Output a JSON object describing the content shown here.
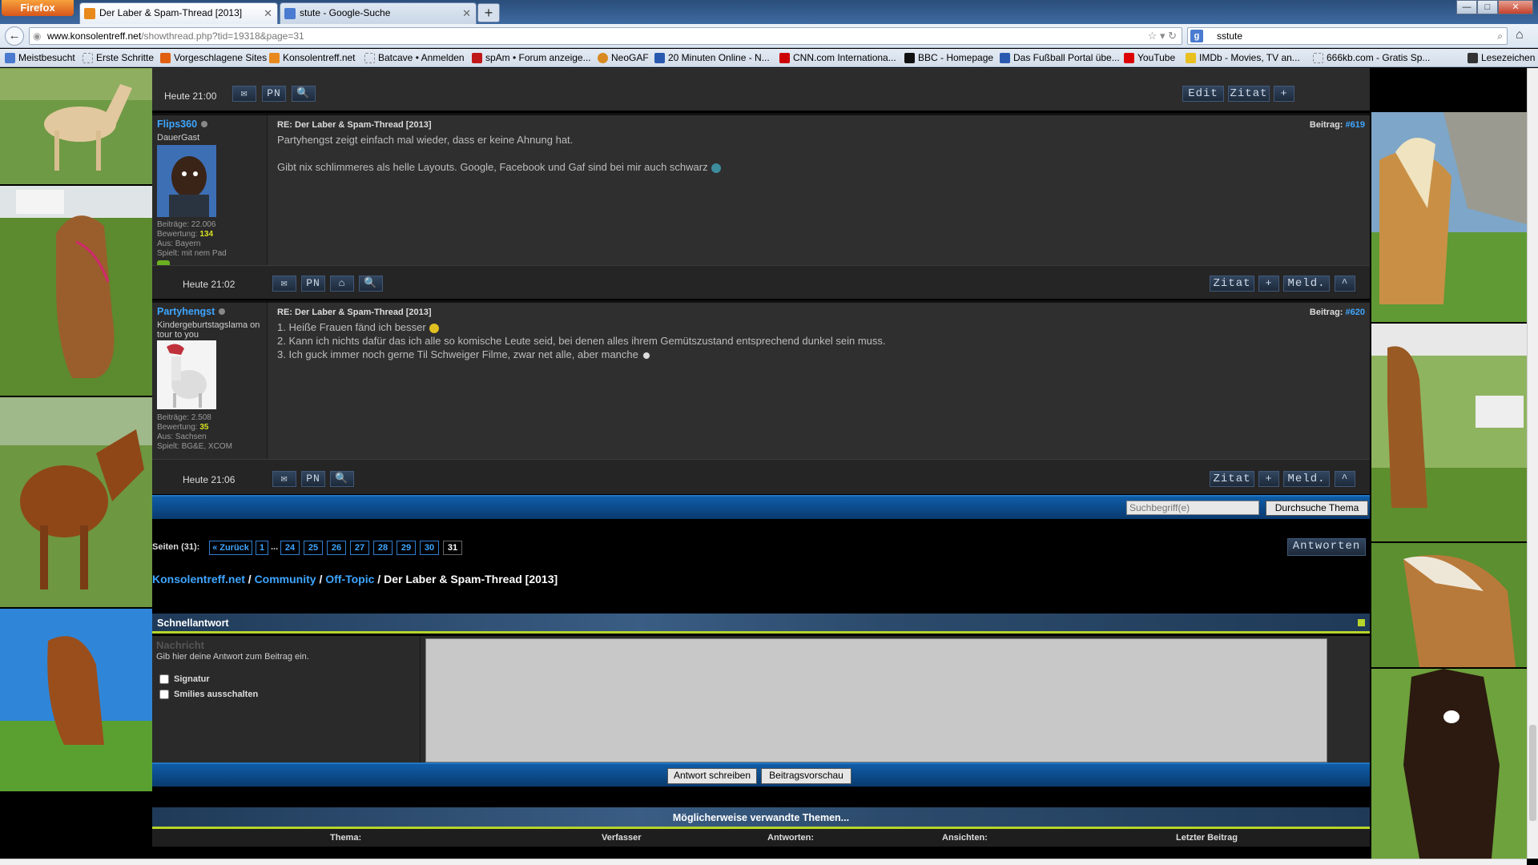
{
  "browser": {
    "menu_label": "Firefox",
    "tabs": [
      {
        "label": "Der Laber & Spam-Thread [2013]",
        "active": true
      },
      {
        "label": "stute - Google-Suche",
        "active": false
      }
    ],
    "url_host": "www.konsolentreff.net",
    "url_path": "/showthread.php?tid=19318&page=31",
    "search_value": "sstute",
    "bookmarks": [
      "Meistbesucht",
      "Erste Schritte",
      "Vorgeschlagene Sites",
      "Konsolentreff.net",
      "Batcave • Anmelden",
      "spAm • Forum anzeige...",
      "NeoGAF",
      "20 Minuten Online - N...",
      "CNN.com Internationa...",
      "BBC - Homepage",
      "Das Fußball Portal übe...",
      "YouTube",
      "IMDb - Movies, TV an...",
      "666kb.com - Gratis Sp..."
    ],
    "bookmarks_menu": "Lesezeichen"
  },
  "prev_post_footer": {
    "time": "Heute 21:00",
    "left_buttons": [
      "✉",
      "PN",
      "🔍"
    ],
    "right_buttons": [
      "Edit",
      "Zitat",
      "+"
    ]
  },
  "posts": [
    {
      "username": "Flips360",
      "user_title": "DauerGast",
      "beitraege_label": "Beiträge: 22.006",
      "bewertung_label": "Bewertung:",
      "bewertung_value": "134",
      "aus": "Aus: Bayern",
      "spielt": "Spielt: mit nem Pad",
      "title": "RE: Der Laber & Spam-Thread [2013]",
      "post_label": "Beitrag:",
      "post_number": "#619",
      "lines": [
        "Partyhengst zeigt einfach mal wieder, dass er keine Ahnung hat.",
        "",
        "Gibt nix schlimmeres als helle Layouts. Google, Facebook und Gaf sind bei mir auch schwarz"
      ],
      "time": "Heute 21:02",
      "left_buttons": [
        "✉",
        "PN",
        "⌂",
        "🔍"
      ],
      "right_buttons": [
        "Zitat",
        "+",
        "Meld.",
        "^"
      ]
    },
    {
      "username": "Partyhengst",
      "user_title": "Kindergeburtstagslama on tour to you",
      "beitraege_label": "Beiträge: 2.508",
      "bewertung_label": "Bewertung:",
      "bewertung_value": "35",
      "aus": "Aus: Sachsen",
      "spielt": "Spielt: BG&E, XCOM",
      "title": "RE: Der Laber & Spam-Thread [2013]",
      "post_label": "Beitrag:",
      "post_number": "#620",
      "lines": [
        "1. Heiße Frauen fänd ich besser",
        "2. Kann ich nichts dafür das ich alle so komische Leute seid, bei denen alles ihrem Gemütszustand entsprechend dunkel sein muss.",
        "3. Ich guck immer noch gerne Til Schweiger Filme, zwar net alle, aber manche"
      ],
      "time": "Heute 21:06",
      "left_buttons": [
        "✉",
        "PN",
        "🔍"
      ],
      "right_buttons": [
        "Zitat",
        "+",
        "Meld.",
        "^"
      ]
    }
  ],
  "thread_search": {
    "placeholder": "Suchbegriff(e)",
    "button": "Durchsuche Thema"
  },
  "pagination": {
    "label": "Seiten (31):",
    "back": "« Zurück",
    "pages": [
      "1",
      "...",
      "24",
      "25",
      "26",
      "27",
      "28",
      "29",
      "30",
      "31"
    ],
    "current": "31",
    "reply_button": "Antworten"
  },
  "breadcrumb": {
    "items": [
      "Konsolentreff.net",
      "Community",
      "Off-Topic"
    ],
    "current": "Der Laber & Spam-Thread [2013]",
    "separator": "/"
  },
  "quick_reply": {
    "title": "Schnellantwort",
    "message_label": "Nachricht",
    "message_hint": "Gib hier deine Antwort zum Beitrag ein.",
    "signature_label": "Signatur",
    "smilies_label": "Smilies ausschalten",
    "submit": "Antwort schreiben",
    "preview": "Beitragsvorschau"
  },
  "related": {
    "title": "Möglicherweise verwandte Themen...",
    "columns": [
      "Thema:",
      "Verfasser",
      "Antworten:",
      "Ansichten:",
      "Letzter Beitrag"
    ]
  },
  "colors": {
    "link": "#3ea6ff",
    "accent_green": "#b7d52a",
    "bar_blue": "#0f5da8"
  }
}
